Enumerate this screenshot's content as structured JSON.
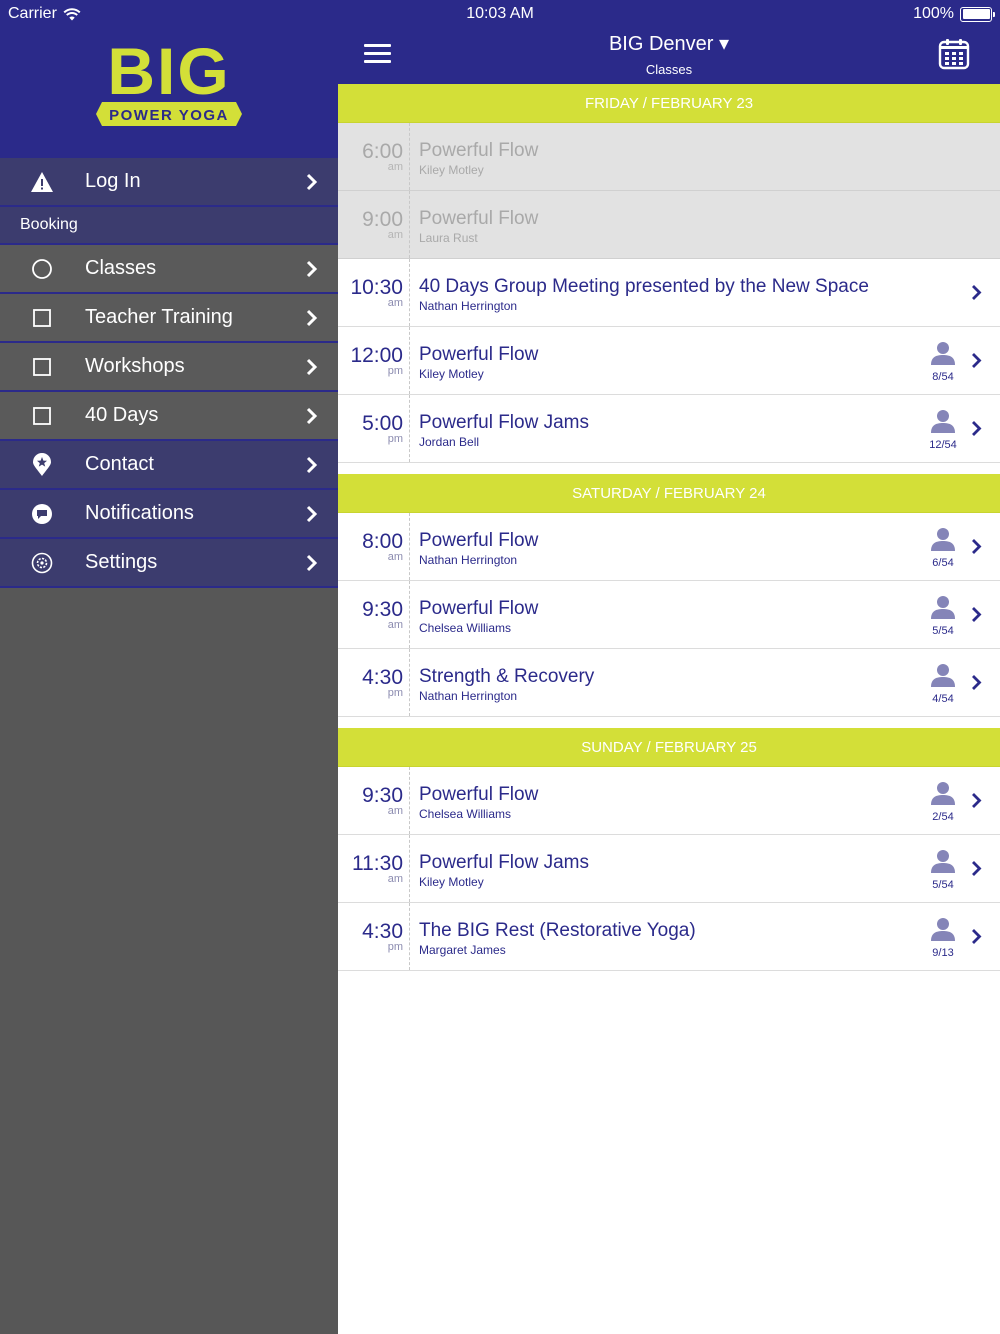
{
  "status_bar": {
    "carrier": "Carrier",
    "time": "10:03 AM",
    "battery": "100%"
  },
  "sidebar": {
    "logo_big": "BIG",
    "logo_sub": "POWER YOGA",
    "login_label": "Log In",
    "section_booking": "Booking",
    "items": [
      {
        "label": "Classes",
        "icon": "circle-icon"
      },
      {
        "label": "Teacher Training",
        "icon": "square-icon"
      },
      {
        "label": "Workshops",
        "icon": "square-icon"
      },
      {
        "label": "40 Days",
        "icon": "square-icon"
      },
      {
        "label": "Contact",
        "icon": "location-pin-icon"
      },
      {
        "label": "Notifications",
        "icon": "chat-bubble-icon"
      },
      {
        "label": "Settings",
        "icon": "gear-icon"
      }
    ]
  },
  "header": {
    "title": "BIG Denver",
    "title_caret": "▾",
    "subtitle": "Classes"
  },
  "colors": {
    "brand_navy": "#2b2a8a",
    "accent_lime": "#d3df38",
    "sidebar_gray": "#575757"
  },
  "days": [
    {
      "label": "FRIDAY / FEBRUARY 23",
      "classes": [
        {
          "time": "6:00",
          "ampm": "am",
          "name": "Powerful Flow",
          "instructor": "Kiley Motley",
          "past": true
        },
        {
          "time": "9:00",
          "ampm": "am",
          "name": "Powerful Flow",
          "instructor": "Laura Rust",
          "past": true
        },
        {
          "time": "10:30",
          "ampm": "am",
          "name": "40 Days Group Meeting presented by the New Space",
          "instructor": "Nathan Herrington"
        },
        {
          "time": "12:00",
          "ampm": "pm",
          "name": "Powerful Flow",
          "instructor": "Kiley Motley",
          "spots": "8/54"
        },
        {
          "time": "5:00",
          "ampm": "pm",
          "name": "Powerful Flow Jams",
          "instructor": "Jordan Bell",
          "spots": "12/54"
        }
      ]
    },
    {
      "label": "SATURDAY / FEBRUARY 24",
      "classes": [
        {
          "time": "8:00",
          "ampm": "am",
          "name": "Powerful Flow",
          "instructor": "Nathan Herrington",
          "spots": "6/54"
        },
        {
          "time": "9:30",
          "ampm": "am",
          "name": "Powerful Flow",
          "instructor": "Chelsea Williams",
          "spots": "5/54"
        },
        {
          "time": "4:30",
          "ampm": "pm",
          "name": "Strength & Recovery",
          "instructor": "Nathan Herrington",
          "spots": "4/54"
        }
      ]
    },
    {
      "label": "SUNDAY / FEBRUARY 25",
      "classes": [
        {
          "time": "9:30",
          "ampm": "am",
          "name": "Powerful Flow",
          "instructor": "Chelsea Williams",
          "spots": "2/54"
        },
        {
          "time": "11:30",
          "ampm": "am",
          "name": "Powerful Flow Jams",
          "instructor": "Kiley Motley",
          "spots": "5/54"
        },
        {
          "time": "4:30",
          "ampm": "pm",
          "name": "The BIG Rest (Restorative Yoga)",
          "instructor": "Margaret James",
          "spots": "9/13"
        }
      ]
    }
  ]
}
